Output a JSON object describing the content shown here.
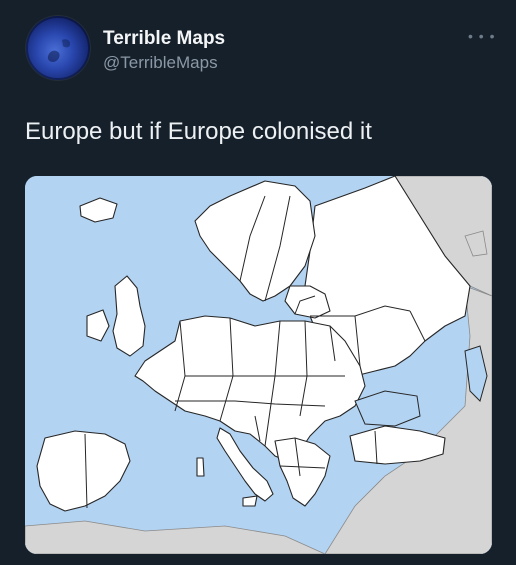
{
  "tweet": {
    "author_name": "Terrible Maps",
    "author_handle": "@TerribleMaps",
    "more_icon": "more-horizontal-icon",
    "text": "Europe but if Europe colonised it"
  },
  "media": {
    "kind": "map",
    "colors": {
      "sea": "#b3d3f2",
      "colonised_land": "#ffffff",
      "other_land": "#d5d5d5",
      "borders": "#2a2a2a"
    }
  },
  "theme": {
    "background": "#15202b",
    "name_color": "#f4f5f6",
    "handle_color": "#8b98a5"
  }
}
